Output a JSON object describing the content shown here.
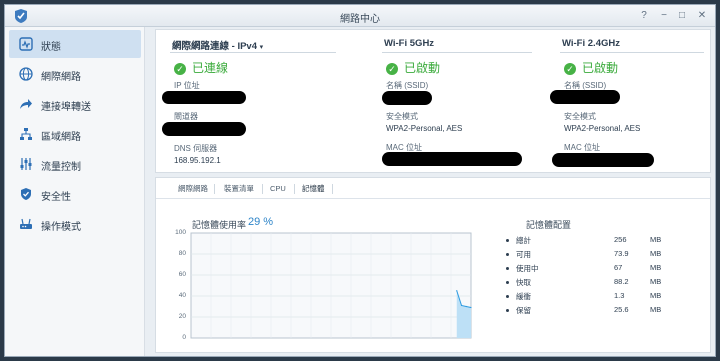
{
  "window": {
    "title": "網路中心",
    "buttons": {
      "help": "?",
      "minimize": "−",
      "maximize": "□",
      "close": "✕"
    }
  },
  "sidebar": {
    "items": [
      {
        "label": "狀態",
        "icon": "status-icon",
        "active": true
      },
      {
        "label": "網際網路",
        "icon": "globe-icon",
        "active": false
      },
      {
        "label": "連接埠轉送",
        "icon": "forward-arrow-icon",
        "active": false
      },
      {
        "label": "區域網路",
        "icon": "network-icon",
        "active": false
      },
      {
        "label": "流量控制",
        "icon": "sliders-icon",
        "active": false
      },
      {
        "label": "安全性",
        "icon": "shield-icon",
        "active": false
      },
      {
        "label": "操作模式",
        "icon": "router-icon",
        "active": false
      }
    ]
  },
  "overview": {
    "internet": {
      "header": "網際網路連線 - IPv4",
      "status": "已連線",
      "ip_label": "IP 位址",
      "gateway_label": "閘道器",
      "dns_label": "DNS 伺服器",
      "dns_value": "168.95.192.1"
    },
    "wifi5": {
      "header": "Wi-Fi 5GHz",
      "status": "已啟動",
      "ssid_label": "名稱 (SSID)",
      "security_label": "安全模式",
      "security_value": "WPA2-Personal, AES",
      "mac_label": "MAC 位址"
    },
    "wifi24": {
      "header": "Wi-Fi 2.4GHz",
      "status": "已啟動",
      "ssid_label": "名稱 (SSID)",
      "security_label": "安全模式",
      "security_value": "WPA2-Personal, AES",
      "mac_label": "MAC 位址"
    }
  },
  "tabs": [
    {
      "label": "網際網路",
      "active": false
    },
    {
      "label": "裝置清單",
      "active": false
    },
    {
      "label": "CPU",
      "active": false
    },
    {
      "label": "記憶體",
      "active": true
    }
  ],
  "memory": {
    "usage_label": "記憶體使用率",
    "usage_value": "29 %",
    "config_title": "記憶體配置",
    "rows": [
      {
        "name": "總計",
        "value": "256",
        "unit": "MB"
      },
      {
        "name": "可用",
        "value": "73.9",
        "unit": "MB"
      },
      {
        "name": "使用中",
        "value": "67",
        "unit": "MB"
      },
      {
        "name": "快取",
        "value": "88.2",
        "unit": "MB"
      },
      {
        "name": "緩衝",
        "value": "1.3",
        "unit": "MB"
      },
      {
        "name": "保留",
        "value": "25.6",
        "unit": "MB"
      }
    ]
  },
  "chart_data": {
    "type": "area",
    "ylim": [
      0,
      100
    ],
    "yticks": [
      "100",
      "80",
      "60",
      "40",
      "20",
      "0"
    ],
    "grid": true,
    "x": [
      0,
      1,
      2,
      3,
      4,
      5,
      6,
      7,
      8,
      9,
      10,
      11,
      12,
      13,
      14,
      15,
      16,
      17,
      18,
      19,
      20,
      21,
      22,
      23,
      24,
      25,
      26,
      27,
      28,
      29,
      30,
      31,
      32,
      33,
      34,
      35,
      36,
      37,
      38,
      39,
      40,
      41,
      42,
      43,
      44,
      45,
      46,
      47,
      48,
      49,
      50,
      51,
      52,
      53,
      54,
      55,
      56,
      57,
      58,
      59
    ],
    "values": [
      null,
      null,
      null,
      null,
      null,
      null,
      null,
      null,
      null,
      null,
      null,
      null,
      null,
      null,
      null,
      null,
      null,
      null,
      null,
      null,
      null,
      null,
      null,
      null,
      null,
      null,
      null,
      null,
      null,
      null,
      null,
      null,
      null,
      null,
      null,
      null,
      null,
      null,
      null,
      null,
      null,
      null,
      null,
      null,
      null,
      null,
      null,
      null,
      null,
      null,
      null,
      null,
      null,
      null,
      null,
      null,
      45,
      31,
      30,
      29
    ],
    "color": "#2d9be0",
    "fill": "#bde0f6"
  },
  "colors": {
    "accent": "#2d84c8",
    "ok": "#3bab3c"
  }
}
